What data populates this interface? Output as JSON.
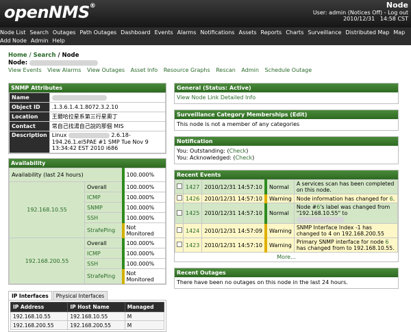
{
  "header": {
    "logo_text": "openNMS",
    "logo_reg": "®",
    "page_title": "Node",
    "user_line": "User: admin (Notices Off) - Log out",
    "date": "2010/12/31",
    "time": "14:58 CST"
  },
  "nav": {
    "row1": [
      "Node List",
      "Search",
      "Outages",
      "Path Outages",
      "Dashboard",
      "Events",
      "Alarms",
      "Notifications",
      "Assets",
      "Reports",
      "Charts",
      "Surveillance",
      "Distributed Map",
      "Map"
    ],
    "row2": [
      "Add Node",
      "Admin",
      "Help"
    ]
  },
  "breadcrumb": {
    "home": "Home",
    "search": "Search",
    "current": "Node",
    "sep": " / "
  },
  "node_label": "Node:",
  "subnav": [
    "View Events",
    "View Alarms",
    "View Outages",
    "Asset Info",
    "Resource Graphs",
    "Rescan",
    "Admin",
    "Schedule Outage"
  ],
  "snmp": {
    "title": "SNMP Attributes",
    "rows": [
      {
        "key": "Name",
        "value": ""
      },
      {
        "key": "Object ID",
        "value": ".1.3.6.1.4.1.8072.3.2.10"
      },
      {
        "key": "Location",
        "value": "王爾哈拉星系第三行星奧丁"
      },
      {
        "key": "Contact",
        "value": "常自己找湯自己說的那個 MIS"
      },
      {
        "key": "Description",
        "value_pre": "Linux",
        "value_post": "2.6.18-194.26.1.el5PAE #1 SMP Tue Nov 9 13:34:42 EST 2010 i686"
      }
    ]
  },
  "availability": {
    "title": "Availability",
    "last24_label": "Availability (last 24 hours)",
    "last24_value": "100.000%",
    "interfaces": [
      {
        "ip": "192.168.10.55",
        "services": [
          {
            "name": "Overall",
            "value": "100.000%"
          },
          {
            "name": "ICMP",
            "value": "100.000%"
          },
          {
            "name": "SNMP",
            "value": "100.000%"
          },
          {
            "name": "SSH",
            "value": "100.000%"
          },
          {
            "name": "StrafePing",
            "value": "Not Monitored"
          }
        ]
      },
      {
        "ip": "192.168.200.55",
        "services": [
          {
            "name": "Overall",
            "value": "100.000%"
          },
          {
            "name": "ICMP",
            "value": "100.000%"
          },
          {
            "name": "SSH",
            "value": "100.000%"
          },
          {
            "name": "StrafePing",
            "value": "Not Monitored"
          }
        ]
      }
    ]
  },
  "tabs": {
    "labels": [
      "IP Interfaces",
      "Physical Interfaces"
    ],
    "columns": [
      "IP Address",
      "IP Host Name",
      "Managed"
    ],
    "rows": [
      [
        "192.168.10.55",
        "192.168.10.55",
        "M"
      ],
      [
        "192.168.200.55",
        "192.168.200.55",
        "M"
      ]
    ]
  },
  "general": {
    "title": "General (Status: Active)",
    "link": "View Node Link Detailed Info"
  },
  "surveillance": {
    "title": "Surveillance Category Memberships (Edit)",
    "text": "This node is not a member of any categories"
  },
  "notification": {
    "title": "Notification",
    "outstanding_label": "You: Outstanding: (",
    "outstanding_link": "Check",
    "acknowledged_label": "You: Acknowledged: (",
    "acknowledged_link": "Check",
    "close": ")"
  },
  "recent_events": {
    "title": "Recent Events",
    "rows": [
      {
        "id": "1427",
        "time": "2010/12/31 14:57:10",
        "severity": "Normal",
        "msg": "A services scan has been completed on this node."
      },
      {
        "id": "1426",
        "time": "2010/12/31 14:57:10",
        "severity": "Warning",
        "msg_pre": "Node information has changed for ",
        "msg_link": "6",
        "msg_post": "."
      },
      {
        "id": "1425",
        "time": "2010/12/31 14:57:10",
        "severity": "Normal",
        "msg_pre": "Node #",
        "msg_link": "6",
        "msg_post": "'s label was changed from \"192.168.10.55\" to"
      },
      {
        "id": "1424",
        "time": "2010/12/31 14:57:09",
        "severity": "Warning",
        "msg": "SNMP Interface Index -1 has changed to 4 on 192.168.200.55"
      },
      {
        "id": "1423",
        "time": "2010/12/31 14:57:10",
        "severity": "Warning",
        "msg_pre": "Primary SNMP interface for node ",
        "msg_link": "6",
        "msg_post": " has changed from to 192.168.10.55."
      }
    ],
    "more": "More..."
  },
  "recent_outages": {
    "title": "Recent Outages",
    "text": "There have been no outages on this node in the last 24 hours."
  }
}
